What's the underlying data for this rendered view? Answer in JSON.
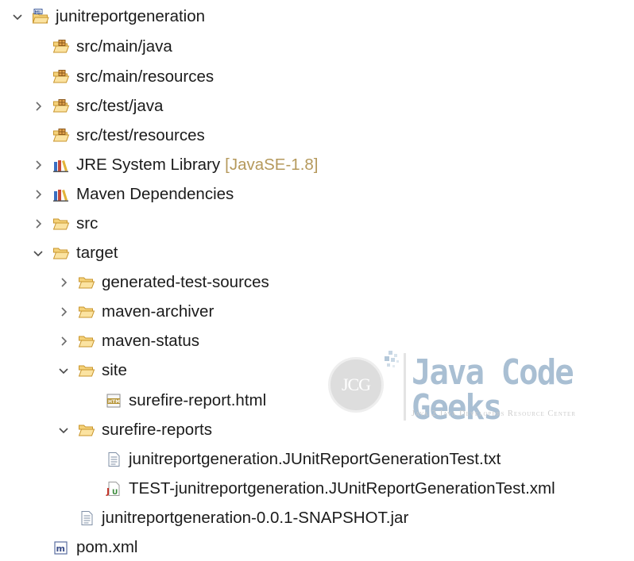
{
  "tree": {
    "project": "junitreportgeneration",
    "src_main_java": "src/main/java",
    "src_main_resources": "src/main/resources",
    "src_test_java": "src/test/java",
    "src_test_resources": "src/test/resources",
    "jre_library": "JRE System Library",
    "jre_version": "[JavaSE-1.8]",
    "maven_deps": "Maven Dependencies",
    "src": "src",
    "target": "target",
    "generated_test_sources": "generated-test-sources",
    "maven_archiver": "maven-archiver",
    "maven_status": "maven-status",
    "site": "site",
    "surefire_report_html": "surefire-report.html",
    "surefire_reports": "surefire-reports",
    "report_txt": "junitreportgeneration.JUnitReportGenerationTest.txt",
    "report_xml": "TEST-junitreportgeneration.JUnitReportGenerationTest.xml",
    "jar": "junitreportgeneration-0.0.1-SNAPSHOT.jar",
    "pom": "pom.xml"
  },
  "watermark": {
    "logo_text": "JCG",
    "title": "Java Code Geeks",
    "subtitle": "Java 2 Java Developers Resource Center"
  },
  "colors": {
    "text": "#1b1b1b",
    "decoration": "#b5995c",
    "folder": "#e8b84a",
    "package": "#c9933a",
    "chevron": "#555555"
  }
}
